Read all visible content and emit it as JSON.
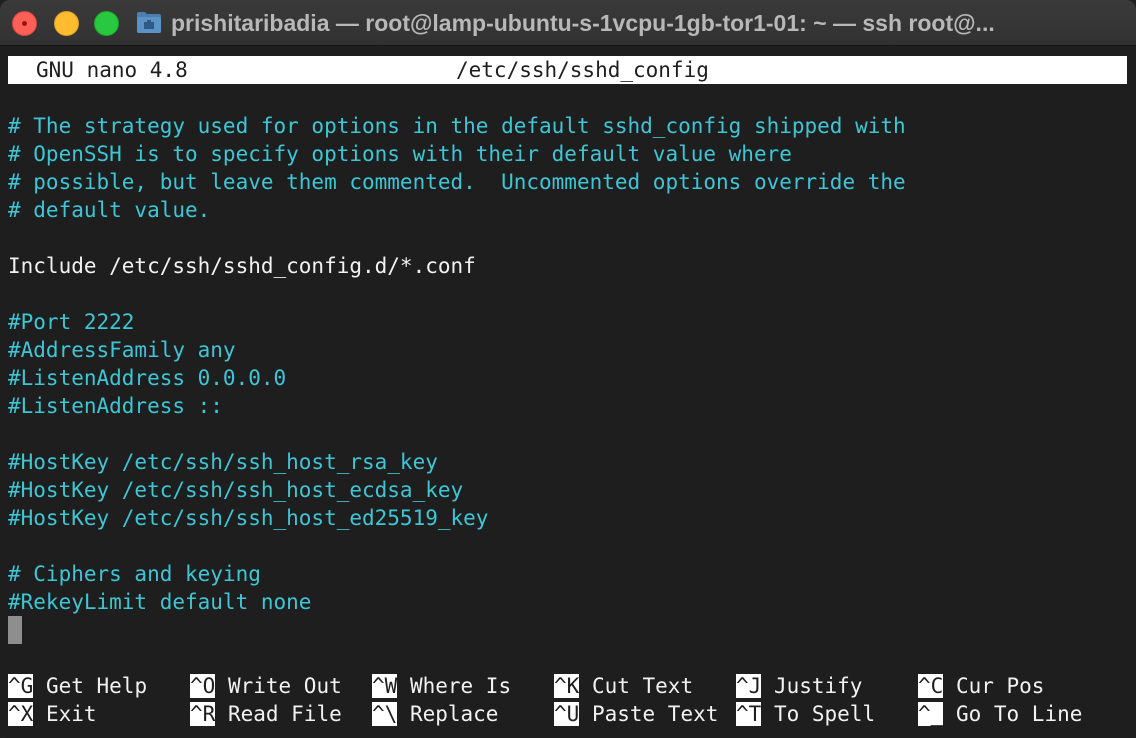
{
  "window": {
    "title": "prishitaribadia — root@lamp-ubuntu-s-1vcpu-1gb-tor1-01: ~ — ssh root@..."
  },
  "nano": {
    "version": "GNU nano 4.8",
    "filename": "/etc/ssh/sshd_config"
  },
  "lines": [
    {
      "text": "# The strategy used for options in the default sshd_config shipped with",
      "type": "comment"
    },
    {
      "text": "# OpenSSH is to specify options with their default value where",
      "type": "comment"
    },
    {
      "text": "# possible, but leave them commented.  Uncommented options override the",
      "type": "comment"
    },
    {
      "text": "# default value.",
      "type": "comment"
    },
    {
      "text": "",
      "type": "blank"
    },
    {
      "text": "Include /etc/ssh/sshd_config.d/*.conf",
      "type": "plain"
    },
    {
      "text": "",
      "type": "blank"
    },
    {
      "text": "#Port 2222",
      "type": "comment"
    },
    {
      "text": "#AddressFamily any",
      "type": "comment"
    },
    {
      "text": "#ListenAddress 0.0.0.0",
      "type": "comment"
    },
    {
      "text": "#ListenAddress ::",
      "type": "comment"
    },
    {
      "text": "",
      "type": "blank"
    },
    {
      "text": "#HostKey /etc/ssh/ssh_host_rsa_key",
      "type": "comment"
    },
    {
      "text": "#HostKey /etc/ssh/ssh_host_ecdsa_key",
      "type": "comment"
    },
    {
      "text": "#HostKey /etc/ssh/ssh_host_ed25519_key",
      "type": "comment"
    },
    {
      "text": "",
      "type": "blank"
    },
    {
      "text": "# Ciphers and keying",
      "type": "comment"
    },
    {
      "text": "#RekeyLimit default none",
      "type": "comment"
    }
  ],
  "shortcuts": [
    {
      "key": "^G",
      "label": "Get Help"
    },
    {
      "key": "^O",
      "label": "Write Out"
    },
    {
      "key": "^W",
      "label": "Where Is"
    },
    {
      "key": "^K",
      "label": "Cut Text"
    },
    {
      "key": "^J",
      "label": "Justify"
    },
    {
      "key": "^C",
      "label": "Cur Pos"
    },
    {
      "key": "^X",
      "label": "Exit"
    },
    {
      "key": "^R",
      "label": "Read File"
    },
    {
      "key": "^\\",
      "label": "Replace"
    },
    {
      "key": "^U",
      "label": "Paste Text"
    },
    {
      "key": "^T",
      "label": "To Spell"
    },
    {
      "key": "^_",
      "label": "Go To Line"
    }
  ],
  "colors": {
    "comment": "#3ec6d6",
    "text": "#f2f2f2",
    "background": "#1e1e1e",
    "close": "#fe5f57",
    "minimize": "#febc2e",
    "maximize": "#28c840"
  }
}
